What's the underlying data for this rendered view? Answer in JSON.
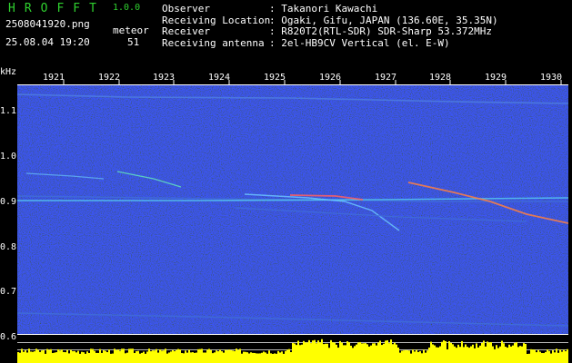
{
  "app": {
    "name": "HROFFT",
    "version": "1.0.0"
  },
  "file": {
    "name": "2508041920.png",
    "datetime": "25.08.04 19:20"
  },
  "meteor": {
    "label": "meteor",
    "count": "51"
  },
  "info": [
    {
      "key": "Observer",
      "value": ": Takanori Kawachi"
    },
    {
      "key": "Receiving Location",
      "value": ": Ogaki, Gifu, JAPAN (136.60E, 35.35N)"
    },
    {
      "key": "Receiver",
      "value": ": R820T2(RTL-SDR) SDR-Sharp 53.372MHz"
    },
    {
      "key": "Receiving antenna",
      "value": ": 2el-HB9CV Vertical (el. E-W)"
    }
  ],
  "axis": {
    "y_unit": "kHz",
    "y_ticks": [
      "1.1",
      "1.0",
      "0.9",
      "0.8",
      "0.7",
      "0.6"
    ],
    "x_ticks": [
      "1921",
      "1922",
      "1923",
      "1924",
      "1925",
      "1926",
      "1927",
      "1928",
      "1929",
      "1930"
    ]
  },
  "colors": {
    "title": "#2fd02f",
    "background": "#000000",
    "noise": "#1a2a9a",
    "level": "#ffff00"
  }
}
